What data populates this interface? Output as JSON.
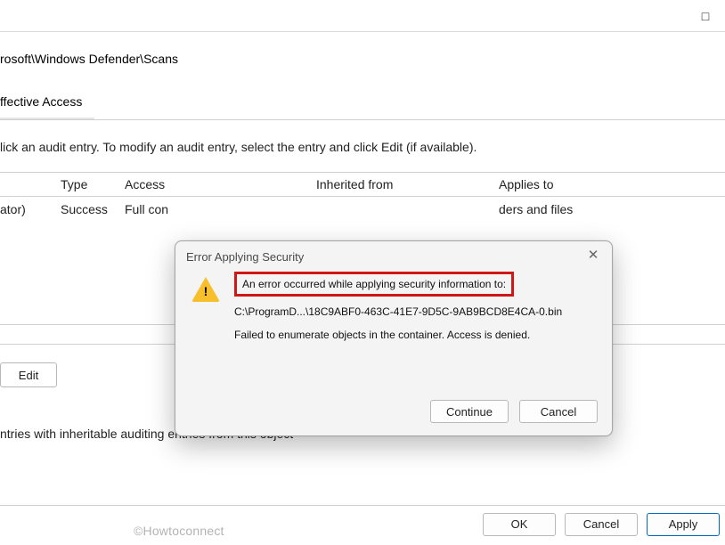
{
  "window": {
    "maximize_icon": "□",
    "path": "rosoft\\Windows Defender\\Scans"
  },
  "tab": {
    "effective_access": "ffective Access"
  },
  "instruction": "lick an audit entry. To modify an audit entry, select the entry and click Edit (if available).",
  "table": {
    "headers": {
      "type": "Type",
      "access": "Access",
      "inherited": "Inherited from",
      "applies": "Applies to"
    },
    "row": {
      "principal": "ator)",
      "type": "Success",
      "access": "Full con",
      "applies": "ders and files"
    }
  },
  "edit_btn": "Edit",
  "checkbox_text": "ntries with inheritable auditing entries from this object",
  "bottom": {
    "ok": "OK",
    "cancel": "Cancel",
    "apply": "Apply"
  },
  "watermark": "©Howtoconnect",
  "dialog": {
    "title": "Error Applying Security",
    "line1": "An error occurred while applying security information to:",
    "line2": "C:\\ProgramD...\\18C9ABF0-463C-41E7-9D5C-9AB9BCD8E4CA-0.bin",
    "line3": "Failed to enumerate objects in the container. Access is denied.",
    "continue": "Continue",
    "cancel": "Cancel"
  }
}
